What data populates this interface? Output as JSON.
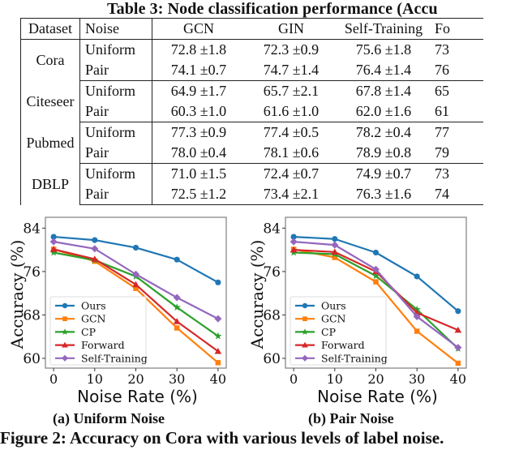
{
  "table": {
    "title": "Table 3: Node classification performance (Accu",
    "headers": [
      "Dataset",
      "Noise",
      "GCN",
      "GIN",
      "Self-Training",
      "Fo"
    ],
    "groups": [
      {
        "dataset": "Cora",
        "rows": [
          {
            "noise": "Uniform",
            "gcn": "72.8 ±1.8",
            "gin": "72.3 ±0.9",
            "self_training": "75.6 ±1.8",
            "forward_partial": "73"
          },
          {
            "noise": "Pair",
            "gcn": "74.1 ±0.7",
            "gin": "74.7 ±1.4",
            "self_training": "76.4 ±1.4",
            "forward_partial": "76"
          }
        ]
      },
      {
        "dataset": "Citeseer",
        "rows": [
          {
            "noise": "Uniform",
            "gcn": "64.9 ±1.7",
            "gin": "65.7 ±2.1",
            "self_training": "67.8 ±1.4",
            "forward_partial": "65"
          },
          {
            "noise": "Pair",
            "gcn": "60.3 ±1.0",
            "gin": "61.6 ±1.0",
            "self_training": "62.0 ±1.6",
            "forward_partial": "61"
          }
        ]
      },
      {
        "dataset": "Pubmed",
        "rows": [
          {
            "noise": "Uniform",
            "gcn": "77.3 ±0.9",
            "gin": "77.4 ±0.5",
            "self_training": "78.2 ±0.4",
            "forward_partial": "77"
          },
          {
            "noise": "Pair",
            "gcn": "78.0 ±0.4",
            "gin": "78.1 ±0.6",
            "self_training": "78.9 ±0.8",
            "forward_partial": "79"
          }
        ]
      },
      {
        "dataset": "DBLP",
        "rows": [
          {
            "noise": "Uniform",
            "gcn": "71.0 ±1.5",
            "gin": "72.4 ±0.7",
            "self_training": "74.9 ±0.7",
            "forward_partial": "73"
          },
          {
            "noise": "Pair",
            "gcn": "72.5 ±1.2",
            "gin": "73.4 ±2.1",
            "self_training": "76.3 ±1.6",
            "forward_partial": "74"
          }
        ]
      }
    ]
  },
  "figure": {
    "caption": "Figure 2: Accuracy on Cora with various levels of label noise."
  },
  "chart_data": [
    {
      "type": "line",
      "subcaption": "(a) Uniform Noise",
      "xlabel": "Noise Rate (%)",
      "ylabel": "Accuracy (%)",
      "x": [
        0,
        10,
        20,
        30,
        40
      ],
      "xticks": [
        "0",
        "10",
        "20",
        "30",
        "40"
      ],
      "yticks": [
        "60",
        "68",
        "76",
        "84"
      ],
      "ytick_values": [
        60,
        68,
        76,
        84
      ],
      "xlim": [
        -2,
        42
      ],
      "ylim": [
        58.2,
        86.0
      ],
      "grid": false,
      "legend_position": "lower-left",
      "series": [
        {
          "name": "Ours",
          "color": "#1f77b4",
          "marker": "circle",
          "values": [
            82.4,
            81.8,
            80.4,
            78.2,
            74.0
          ]
        },
        {
          "name": "GCN",
          "color": "#ff7f0e",
          "marker": "square",
          "values": [
            80.1,
            77.9,
            72.9,
            65.6,
            59.2
          ]
        },
        {
          "name": "CP",
          "color": "#2ca02c",
          "marker": "star",
          "values": [
            79.5,
            78.1,
            75.1,
            69.4,
            64.1
          ]
        },
        {
          "name": "Forward",
          "color": "#d62728",
          "marker": "triangle",
          "values": [
            80.1,
            78.3,
            73.6,
            66.8,
            61.3
          ]
        },
        {
          "name": "Self-Training",
          "color": "#9467bd",
          "marker": "diamond",
          "values": [
            81.5,
            80.2,
            75.5,
            71.2,
            67.3
          ]
        }
      ]
    },
    {
      "type": "line",
      "subcaption": "(b) Pair Noise",
      "xlabel": "Noise Rate (%)",
      "ylabel": "Accuracy (%)",
      "x": [
        0,
        10,
        20,
        30,
        40
      ],
      "xticks": [
        "0",
        "10",
        "20",
        "30",
        "40"
      ],
      "yticks": [
        "60",
        "68",
        "76",
        "84"
      ],
      "ytick_values": [
        60,
        68,
        76,
        84
      ],
      "xlim": [
        -2,
        42
      ],
      "ylim": [
        58.2,
        86.0
      ],
      "grid": false,
      "legend_position": "lower-left",
      "series": [
        {
          "name": "Ours",
          "color": "#1f77b4",
          "marker": "circle",
          "values": [
            82.4,
            82.0,
            79.5,
            75.1,
            68.7
          ]
        },
        {
          "name": "GCN",
          "color": "#ff7f0e",
          "marker": "square",
          "values": [
            80.1,
            78.6,
            74.1,
            65.0,
            59.1
          ]
        },
        {
          "name": "CP",
          "color": "#2ca02c",
          "marker": "star",
          "values": [
            79.5,
            79.2,
            75.2,
            69.0,
            61.8
          ]
        },
        {
          "name": "Forward",
          "color": "#d62728",
          "marker": "triangle",
          "values": [
            80.0,
            79.6,
            76.0,
            68.4,
            65.2
          ]
        },
        {
          "name": "Self-Training",
          "color": "#9467bd",
          "marker": "diamond",
          "values": [
            81.5,
            80.9,
            76.4,
            67.7,
            62.0
          ]
        }
      ]
    }
  ]
}
